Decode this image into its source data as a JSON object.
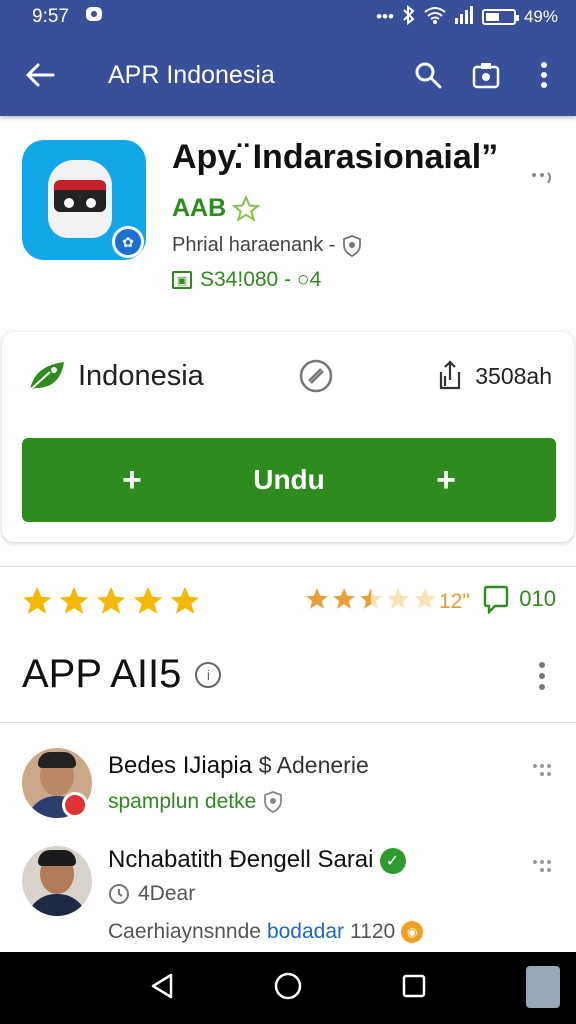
{
  "status_bar": {
    "time": "9:57",
    "battery": "49%",
    "battery_level": 0.49,
    "icons": [
      "notification-icon",
      "dots-icon",
      "bluetooth-icon",
      "wifi-icon",
      "signal-icon",
      "battery-icon"
    ]
  },
  "app_bar": {
    "title": "APR Indonesia",
    "icons": [
      "back-arrow-icon",
      "search-icon",
      "share-icon",
      "more-vert-icon"
    ]
  },
  "app": {
    "name": "Apy.̈ Indarasionaial”",
    "developer": "AAB",
    "description": "Phrial haraenank -",
    "price": "S34!080 - ○4",
    "icon_colors": {
      "background": "#12a7e8",
      "badge": "#1b6fd1"
    }
  },
  "install_card": {
    "region": "Indonesia",
    "size": "3508ah",
    "button_label": "Undu",
    "plus_left": "+",
    "plus_right": "+",
    "accent": "#2e8b1d"
  },
  "ratings": {
    "left_stars_filled": 5,
    "right_stars_value": 2.5,
    "right_count": "12\"",
    "comments_count": "010"
  },
  "section": {
    "title": "APP AII5",
    "info_glyph": "i"
  },
  "reviews": [
    {
      "name": "Bedes IJiapia",
      "name_suffix": "$ Adenerie",
      "subtitle": "spamplun detke",
      "subtitle_color": "#2e8b1d"
    },
    {
      "name": "Nchabatith Ðengell Sarai",
      "verified_glyph": "✓",
      "time": "4Dear",
      "text_prefix": "Caerhiaynsnnde",
      "text_link": "bodadar",
      "text_suffix": "1120"
    }
  ],
  "nav_bar": {
    "icons": [
      "back-triangle-icon",
      "home-circle-icon",
      "recents-square-icon"
    ]
  }
}
